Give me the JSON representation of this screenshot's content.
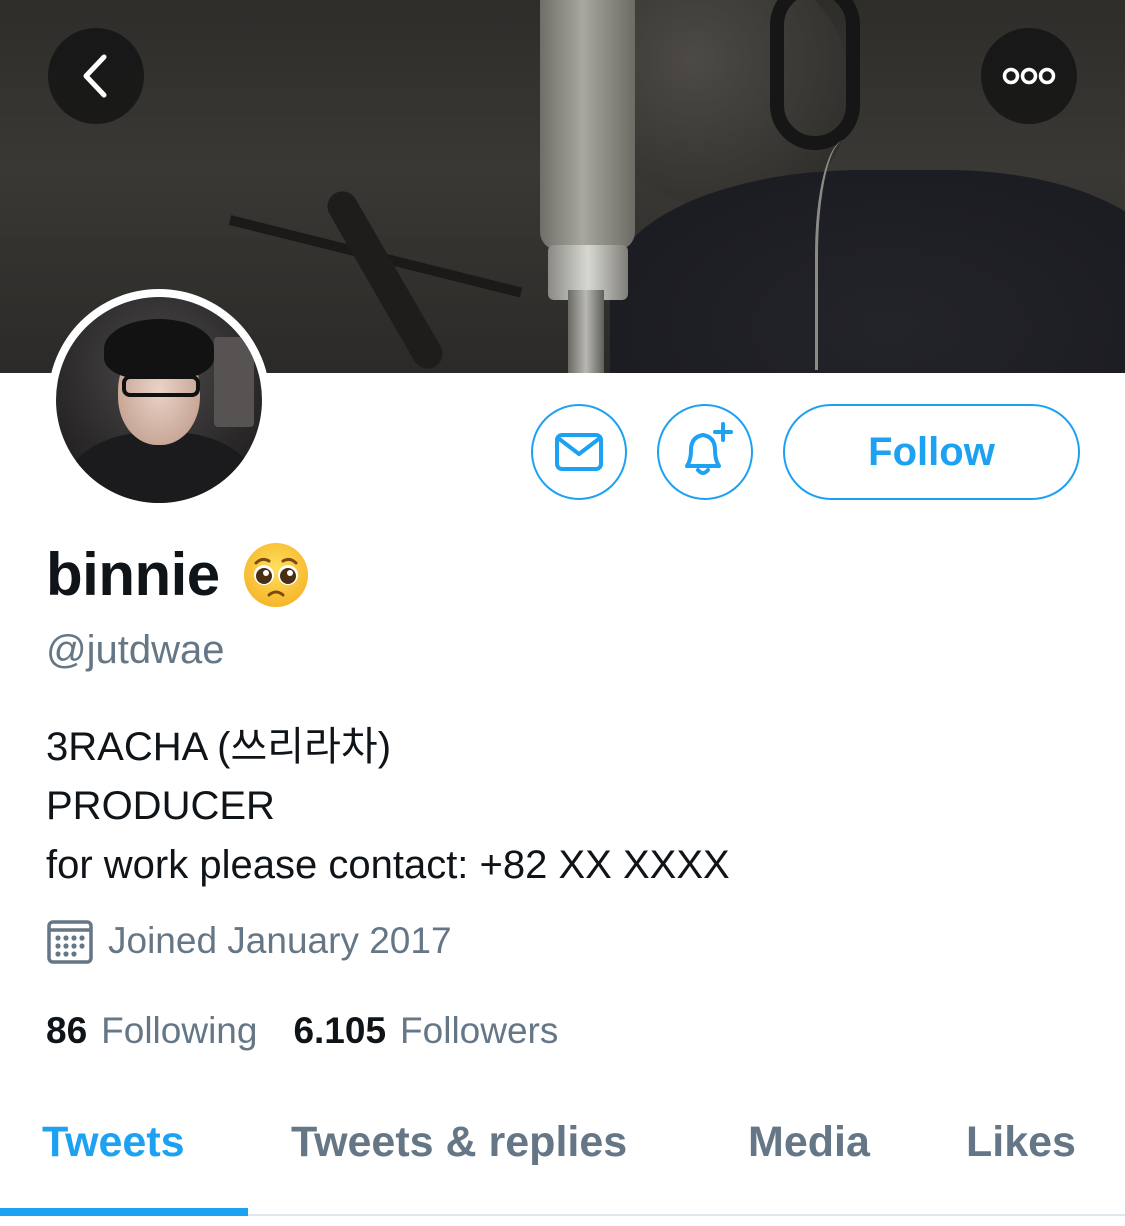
{
  "profile": {
    "display_name": "binnie",
    "emoji": "pleading-face-emoji",
    "handle": "@jutdwae",
    "bio_lines": [
      "3RACHA (쓰리라차)",
      "PRODUCER",
      "for work please contact: +82 XX XXXX"
    ],
    "joined": "Joined January 2017"
  },
  "stats": {
    "following_count": "86",
    "following_label": "Following",
    "followers_count": "6.105",
    "followers_label": "Followers"
  },
  "actions": {
    "follow_label": "Follow",
    "message_icon": "envelope-icon",
    "notify_icon": "bell-plus-icon",
    "back_icon": "chevron-left-icon",
    "more_icon": "more-dots-icon"
  },
  "tabs": [
    {
      "label": "Tweets",
      "active": true
    },
    {
      "label": "Tweets & replies",
      "active": false
    },
    {
      "label": "Media",
      "active": false
    },
    {
      "label": "Likes",
      "active": false
    }
  ],
  "colors": {
    "accent": "#1da1f2",
    "secondary_text": "#657786",
    "primary_text": "#0f1419"
  }
}
